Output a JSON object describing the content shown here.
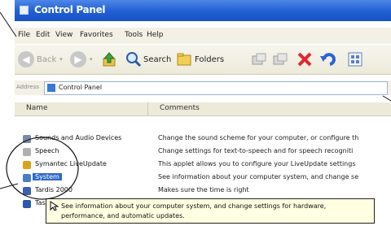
{
  "window": {
    "title": "Control Panel"
  },
  "menu": [
    "File",
    "Edit",
    "View",
    "Favorites",
    "Tools",
    "Help"
  ],
  "toolbar": {
    "back_label": "Back",
    "search_label": "Search",
    "folders_label": "Folders"
  },
  "address": {
    "label": "Address",
    "value": "Control Panel"
  },
  "columns": {
    "name": "Name",
    "comments": "Comments"
  },
  "rows": [
    {
      "name": "Sounds and Audio Devices",
      "comment": "Change the sound scheme for your computer, or configure th"
    },
    {
      "name": "Speech",
      "comment": "Change settings for text-to-speech and for speech recogniti"
    },
    {
      "name": "Symantec LiveUpdate",
      "comment": "This applet allows you to configure your LiveUpdate settings"
    },
    {
      "name": "System",
      "comment": "See information about your computer system, and change se"
    },
    {
      "name": "Tardis 2000",
      "comment": "Makes sure the time is right"
    },
    {
      "name": "Taskbar",
      "comment": ""
    }
  ],
  "tooltip": {
    "text": "See information about your computer system, and change settings for hardware, performance, and automatic updates."
  },
  "colors": {
    "title_bar": "#1f5fd4",
    "selection": "#316ac5",
    "tooltip_bg": "#ffffe1"
  },
  "icons": [
    "control-panel-icon",
    "back-icon",
    "forward-icon",
    "up-folder-icon",
    "search-icon",
    "folders-icon",
    "move-to-icon",
    "copy-to-icon",
    "delete-icon",
    "undo-icon",
    "views-icon"
  ]
}
